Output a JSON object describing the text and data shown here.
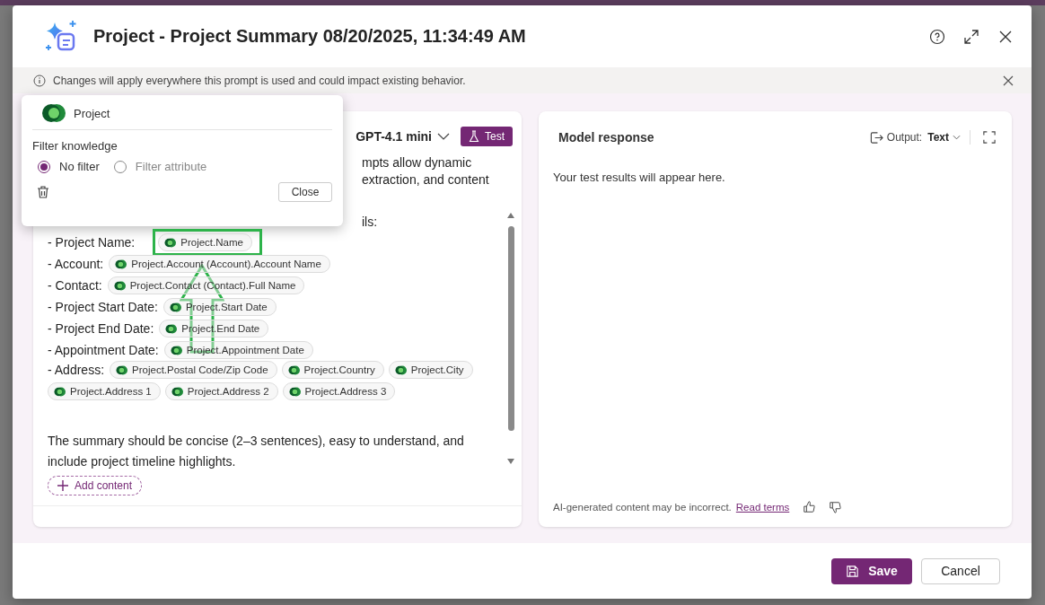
{
  "dialog": {
    "title": "Project - Project Summary 08/20/2025, 11:34:49 AM",
    "banner": "Changes will apply everywhere this prompt is used and could impact existing behavior."
  },
  "popover": {
    "entity": "Project",
    "heading": "Filter knowledge",
    "options": [
      {
        "label": "No filter",
        "selected": true
      },
      {
        "label": "Filter attribute",
        "selected": false
      }
    ],
    "close_button": "Close"
  },
  "prompt_card": {
    "model": "GPT-4.1 mini",
    "test_button": "Test",
    "description": [
      "mpts allow dynamic",
      "extraction, and content"
    ],
    "editor_first_line": "ils:",
    "fields": [
      {
        "label": "- Project Name:",
        "chips": [
          {
            "text": "Project.Name",
            "highlighted": true
          }
        ]
      },
      {
        "label": "- Account:",
        "chips": [
          {
            "text": "Project.Account (Account).Account Name",
            "highlighted": false
          }
        ]
      },
      {
        "label": "- Contact:",
        "chips": [
          {
            "text": "Project.Contact (Contact).Full Name",
            "highlighted": false
          }
        ]
      },
      {
        "label": "- Project Start Date:",
        "chips": [
          {
            "text": "Project.Start Date",
            "highlighted": false
          }
        ]
      },
      {
        "label": "- Project End Date:",
        "chips": [
          {
            "text": "Project.End Date",
            "highlighted": false
          }
        ]
      },
      {
        "label": "- Appointment Date:",
        "chips": [
          {
            "text": "Project.Appointment Date",
            "highlighted": false
          }
        ]
      },
      {
        "label": "- Address:",
        "chips": [
          {
            "text": "Project.Postal Code/Zip Code",
            "highlighted": false
          },
          {
            "text": "Project.Country",
            "highlighted": false
          },
          {
            "text": "Project.City",
            "highlighted": false
          },
          {
            "text": "Project.Address 1",
            "highlighted": false
          },
          {
            "text": "Project.Address 2",
            "highlighted": false
          },
          {
            "text": "Project.Address 3",
            "highlighted": false
          }
        ]
      }
    ],
    "closing_text": "The summary should be concise (2–3 sentences), easy to understand, and include project timeline highlights.",
    "add_button": "Add content"
  },
  "response_card": {
    "title": "Model response",
    "output_label": "Output:",
    "output_value": "Text",
    "placeholder_text": "Your test results will appear here.",
    "disclaimer": "AI-generated content may be incorrect.",
    "terms_link": "Read terms"
  },
  "footer": {
    "buttons": [
      {
        "label": "Save",
        "kind": "primary"
      },
      {
        "label": "Cancel",
        "kind": "secondary"
      }
    ]
  }
}
